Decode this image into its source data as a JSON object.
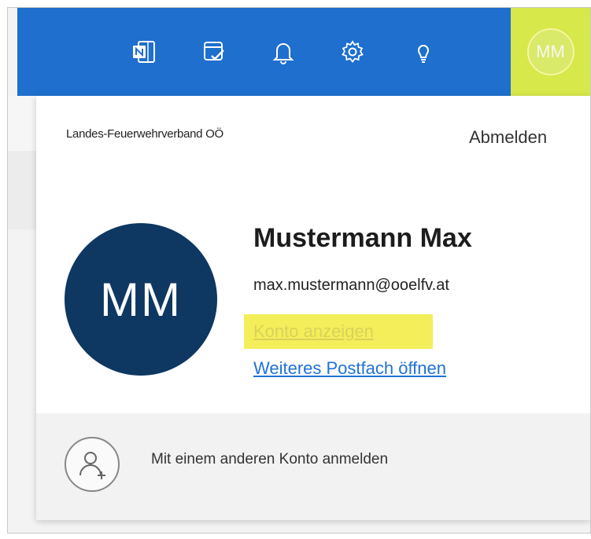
{
  "topbar": {
    "icons": [
      "onenote-icon",
      "calendar-check-icon",
      "bell-icon",
      "settings-gear-icon",
      "lightbulb-icon"
    ],
    "avatar_initials": "MM",
    "color": "#1e6fce",
    "highlight_color": "#d6e84a"
  },
  "account": {
    "organization": "Landes-Feuerwehrverband OÖ",
    "signout_label": "Abmelden",
    "initials": "MM",
    "name": "Mustermann Max",
    "email": "max.mustermann@ooelfv.at",
    "view_account_label": "Konto anzeigen",
    "open_mailbox_label": "Weiteres Postfach öffnen",
    "avatar_color": "#0e3761"
  },
  "footer": {
    "other_account_label": "Mit einem anderen Konto anmelden"
  }
}
